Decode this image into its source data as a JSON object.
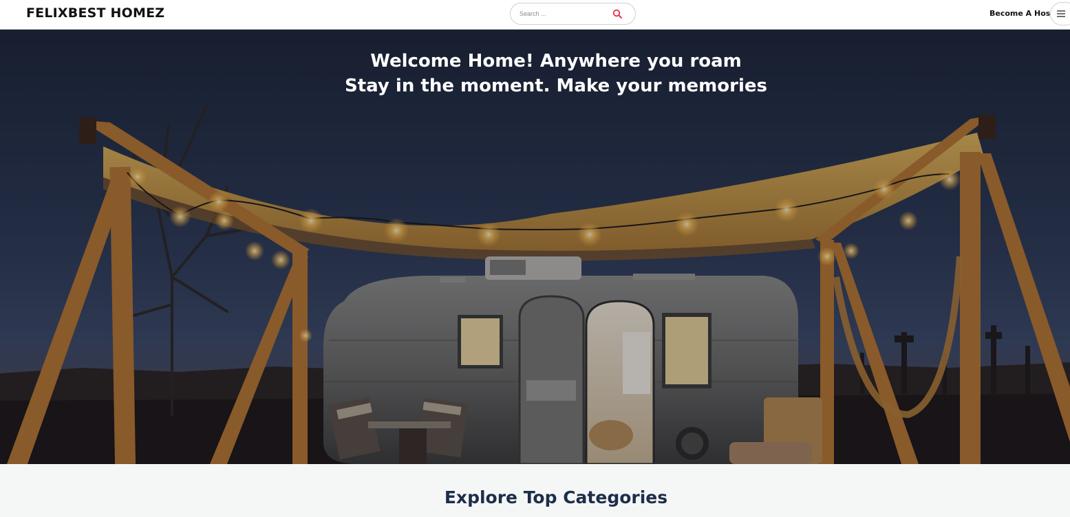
{
  "header": {
    "logo": "FELIXBEST HOMEZ",
    "search_placeholder": "Search ...",
    "search_icon": "search-icon",
    "become_host": "Become A Host",
    "menu_icon": "menu-icon"
  },
  "hero": {
    "line1": "Welcome Home! Anywhere you roam",
    "line2": "Stay in the moment. Make your memories"
  },
  "categories": {
    "title": "Explore Top Categories"
  },
  "colors": {
    "accent": "#e8304a",
    "heading": "#1c2e4a",
    "section_bg": "#f5f7f7"
  }
}
